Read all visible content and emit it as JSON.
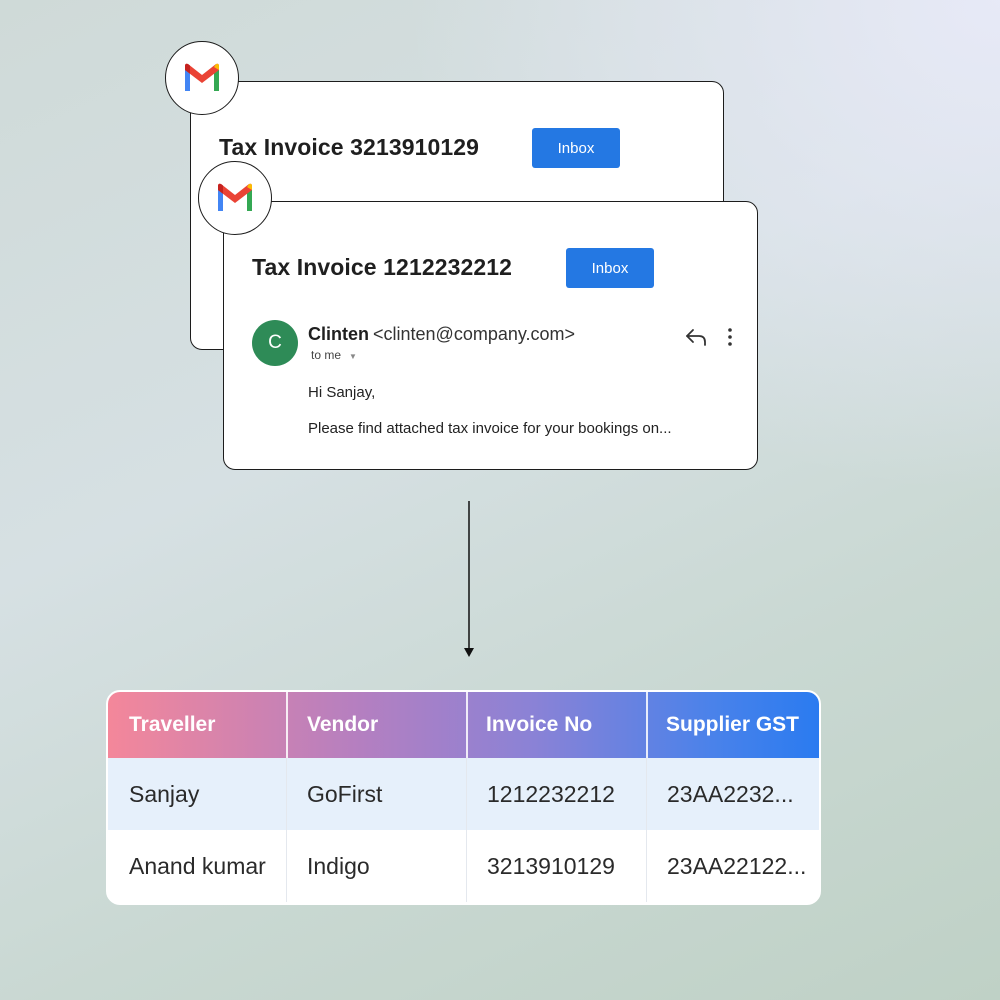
{
  "emails": [
    {
      "subject": "Tax Invoice 3213910129",
      "label": "Inbox"
    },
    {
      "subject": "Tax Invoice 1212232212",
      "label": "Inbox",
      "avatar_initial": "C",
      "sender_name": "Clinten",
      "sender_email": "<clinten@company.com>",
      "recipient": "to me",
      "greeting": "Hi Sanjay,",
      "preview": "Please find attached tax invoice for your bookings on..."
    }
  ],
  "table": {
    "headers": [
      "Traveller",
      "Vendor",
      "Invoice No",
      "Supplier GST"
    ],
    "rows": [
      [
        "Sanjay",
        "GoFirst",
        "1212232212",
        "23AA2232..."
      ],
      [
        "Anand kumar",
        "Indigo",
        "3213910129",
        "23AA22122..."
      ]
    ]
  },
  "colors": {
    "inbox_button": "#2478e3",
    "avatar": "#2e8b57",
    "header_gradient_start": "#f4879a",
    "header_gradient_end": "#2a7bf0",
    "row_highlight": "#e6f0fb"
  },
  "icons": [
    "gmail-icon",
    "reply-icon",
    "more-vertical-icon",
    "chevron-down-icon",
    "arrow-down-icon"
  ]
}
